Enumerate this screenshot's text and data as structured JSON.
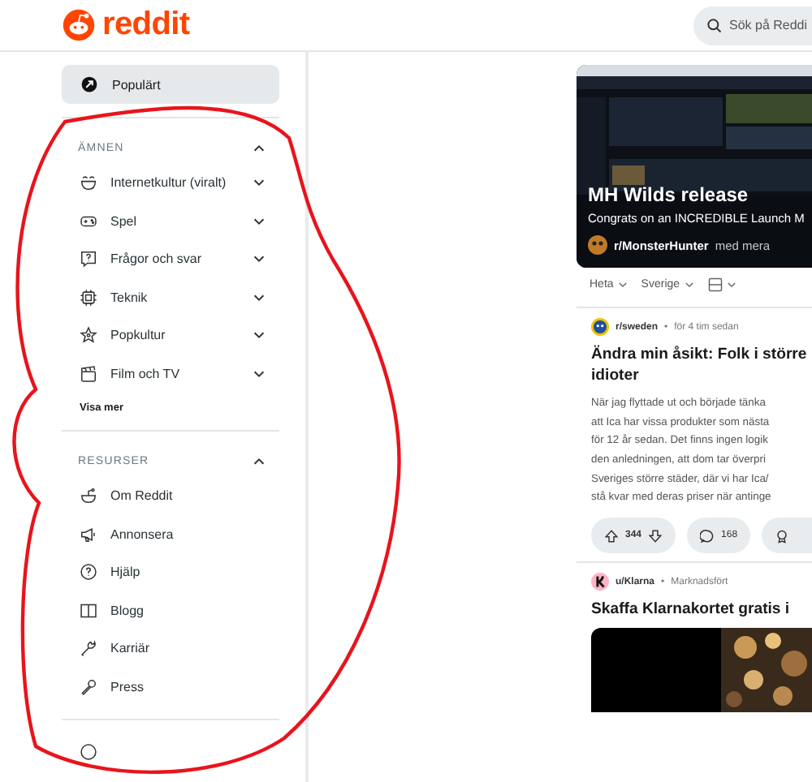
{
  "header": {
    "logo_text": "reddit",
    "search": {
      "placeholder": "Sök på Reddi"
    }
  },
  "sidebar": {
    "top_item": {
      "label": "Populärt",
      "selected": true
    },
    "sections": [
      {
        "title": "ÄMNEN",
        "expanded": true,
        "items": [
          {
            "label": "Internetkultur (viralt)",
            "expanded": false
          },
          {
            "label": "Spel",
            "expanded": false
          },
          {
            "label": "Frågor och svar",
            "expanded": false
          },
          {
            "label": "Teknik",
            "expanded": false
          },
          {
            "label": "Popkultur",
            "expanded": false
          },
          {
            "label": "Film och TV",
            "expanded": false
          }
        ],
        "show_more": "Visa mer"
      },
      {
        "title": "RESURSER",
        "expanded": true,
        "items": [
          {
            "label": "Om Reddit"
          },
          {
            "label": "Annonsera"
          },
          {
            "label": "Hjälp"
          },
          {
            "label": "Blogg"
          },
          {
            "label": "Karriär"
          },
          {
            "label": "Press"
          }
        ]
      }
    ]
  },
  "feed": {
    "featured": {
      "kind": "picture",
      "title": "MH Wilds release",
      "subtitle": "Congrats on an INCREDIBLE Launch M",
      "community": "r/MonsterHunter",
      "suffix": "med mera"
    },
    "sort_controls": [
      {
        "kind": "dropdown",
        "label": "Heta"
      },
      {
        "kind": "dropdown",
        "label": "Sverige"
      },
      {
        "kind": "layout"
      }
    ],
    "posts": [
      {
        "kind": "post",
        "community": "r/sweden",
        "separator": "•",
        "time": "för 4 tim sedan",
        "title_lines": [
          "Ändra min åsikt: Folk i större",
          "idioter"
        ],
        "body_lines": [
          "När jag flyttade ut och började tänka",
          "att Ica har vissa produkter som nästa",
          "för 12 år sedan. Det finns ingen logik",
          "den anledningen, att dom tar överpri",
          "Sveriges större städer, där vi har Ica/",
          "stå kvar med deras priser när antinge"
        ],
        "votes": "344",
        "comments": "168"
      },
      {
        "kind": "ad",
        "community": "u/Klarna",
        "separator": "•",
        "time": "Marknadsfört",
        "title_lines": [
          "Skaffa Klarnakortet gratis i"
        ],
        "media": {
          "kind": "picture"
        }
      }
    ]
  }
}
